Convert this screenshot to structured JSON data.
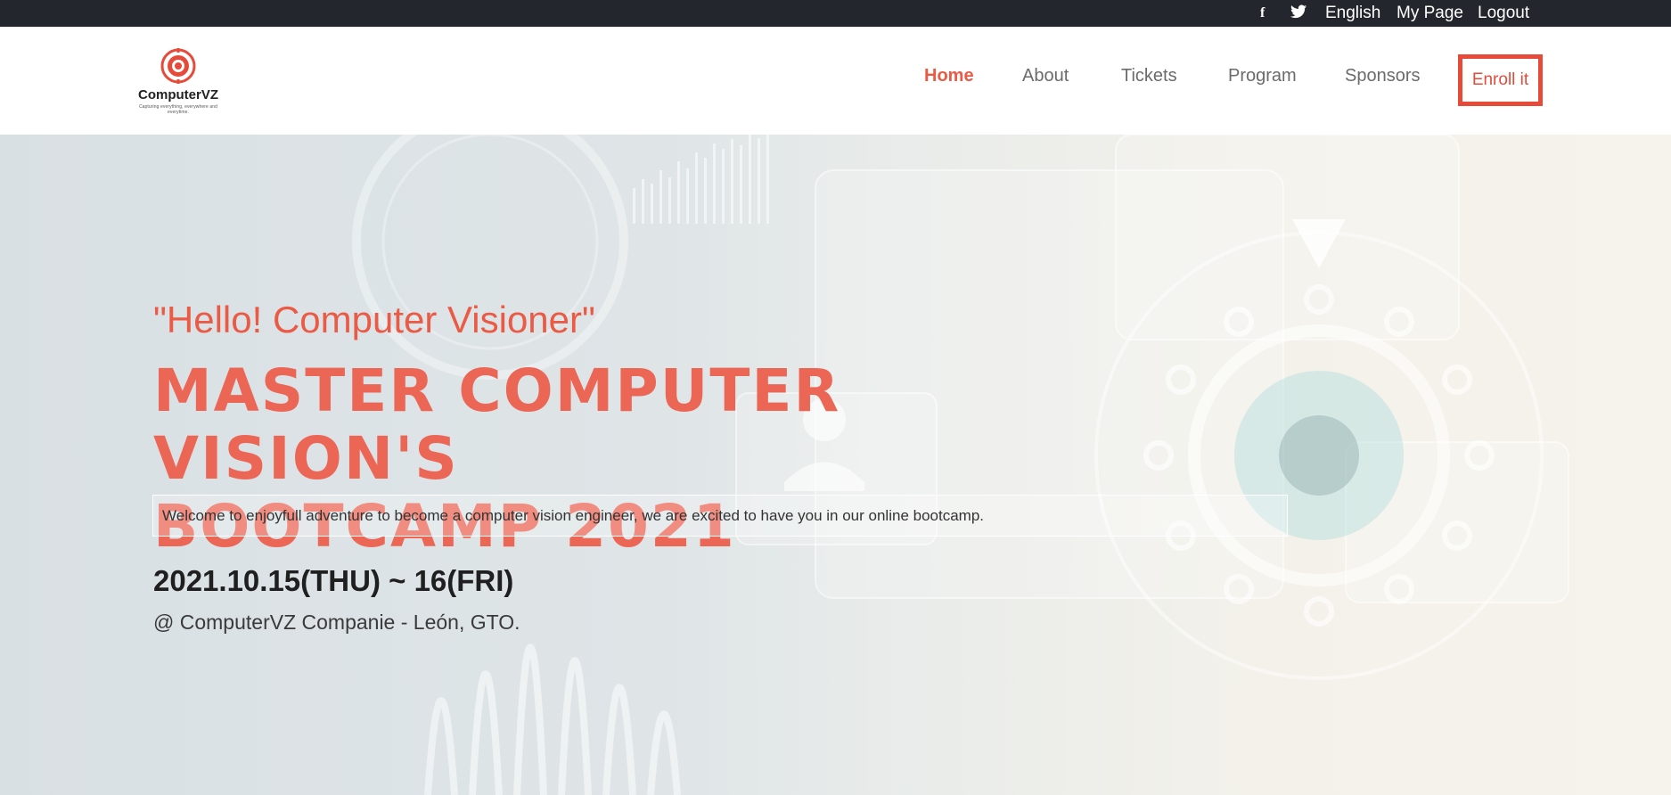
{
  "topbar": {
    "facebook_icon": "facebook-icon",
    "twitter_icon": "twitter-icon",
    "language": "English",
    "my_page": "My Page",
    "logout": "Logout"
  },
  "header": {
    "logo": {
      "brand": "ComputerVZ",
      "tagline": "Capturing everything, everywhere and everytime."
    },
    "nav": [
      "Home",
      "About",
      "Tickets",
      "Program",
      "Sponsors"
    ],
    "active_nav": "Home",
    "enroll_label": "Enroll it"
  },
  "hero": {
    "greeting": "\"Hello! Computer Visioner\"",
    "title_line1": "MASTER COMPUTER VISION'S",
    "title_line2": "BOOTCAMP 2021",
    "welcome": "Welcome to enjoyfull adventure to become a computer vision engineer, we are excited to have you in our online bootcamp.",
    "date": "2021.10.15(THU) ~ 16(FRI)",
    "venue": "@ ComputerVZ Companie - León, GTO."
  },
  "colors": {
    "accent": "#ea5a45",
    "enroll_border": "#e84a3a",
    "topbar_bg": "#23262d"
  }
}
